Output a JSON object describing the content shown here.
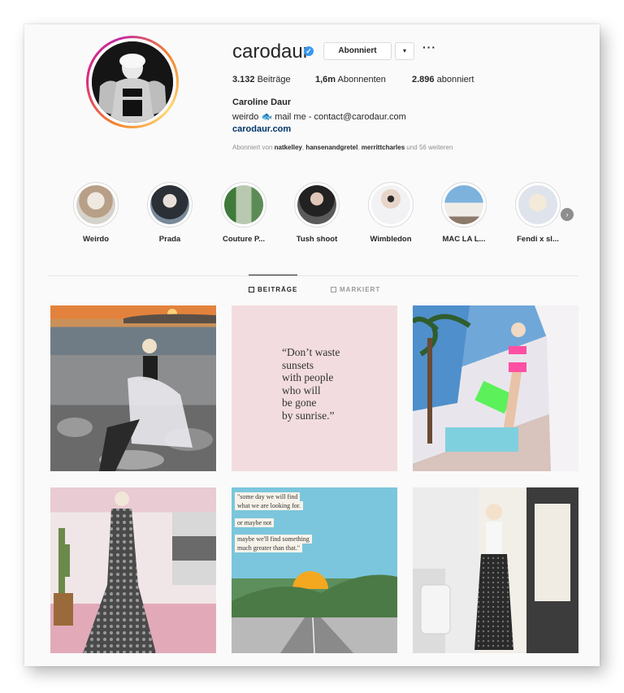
{
  "profile": {
    "username": "carodaur",
    "follow_label": "Abonniert",
    "dropdown_icon": "▾",
    "more_icon": "···",
    "stats": {
      "posts_count": "3.132",
      "posts_label": "Beiträge",
      "followers_count": "1,6m",
      "followers_label": "Abonnenten",
      "following_count": "2.896",
      "following_label": "abonniert"
    },
    "full_name": "Caroline Daur",
    "bio": "weirdo 🐟 mail me - contact@carodaur.com",
    "website": "carodaur.com",
    "followed_by": {
      "prefix": "Abonniert von",
      "names": [
        "natkelley",
        "hansenandgretel",
        "merrittcharles"
      ],
      "suffix": "und 56 weiteren"
    }
  },
  "highlights": [
    {
      "label": "Weirdo",
      "color": "#c9b8a8"
    },
    {
      "label": "Prada",
      "color": "#4a4f57"
    },
    {
      "label": "Couture P...",
      "color": "#5e8f5a"
    },
    {
      "label": "Tush shoot",
      "color": "#3c3c3c"
    },
    {
      "label": "Wimbledon",
      "color": "#e8e8ea"
    },
    {
      "label": "MAC LA L...",
      "color": "#7da4c9"
    },
    {
      "label": "Fendi x sl...",
      "color": "#dfe3ea"
    }
  ],
  "tabs": {
    "posts": "BEITRÄGE",
    "tagged": "MARKIERT"
  },
  "posts": {
    "quote_lines": [
      "“Don’t waste",
      "sunsets",
      "with people",
      "who will",
      "be gone",
      "by sunrise.”"
    ],
    "notes": [
      "\"some day we will find",
      "what we are looking for.",
      "or maybe not",
      "maybe we'll find something",
      "much greater than that.\""
    ]
  },
  "colors": {
    "accent_link": "#003569",
    "verified": "#3897f0",
    "muted_text": "#8e8e8e"
  }
}
